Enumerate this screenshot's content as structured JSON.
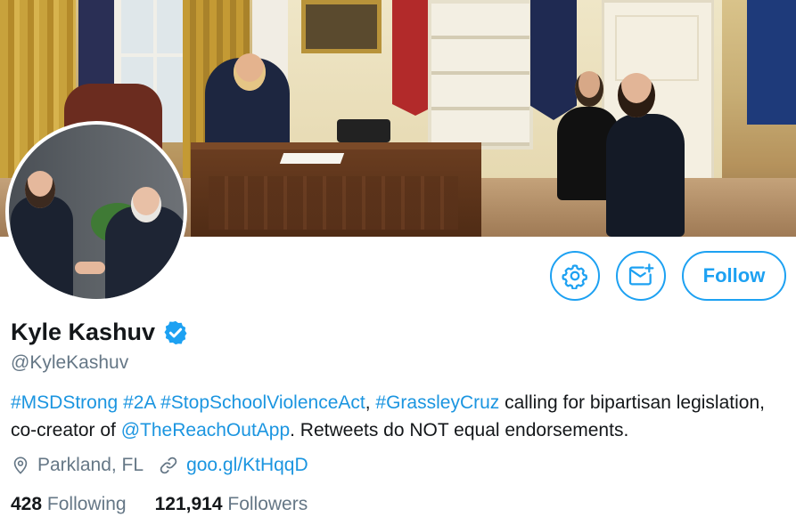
{
  "profile": {
    "name": "Kyle Kashuv",
    "handle": "@KyleKashuv",
    "verified": true,
    "bio": {
      "tag1": "#MSDStrong",
      "tag2": "#2A",
      "tag3": "#StopSchoolViolenceAct",
      "comma": ",",
      "tag4": "#GrassleyCruz",
      "text1": " calling for bipartisan legislation, co-creator of ",
      "mention": "@TheReachOutApp",
      "text2": ". Retweets do NOT equal endorsements."
    },
    "location": "Parkland, FL",
    "website": "goo.gl/KtHqqD"
  },
  "actions": {
    "follow_label": "Follow",
    "settings_icon": "gear-icon",
    "message_icon": "envelope-plus-icon"
  },
  "stats": {
    "following_count": "428",
    "following_label": "Following",
    "followers_count": "121,914",
    "followers_label": "Followers"
  },
  "colors": {
    "accent": "#1da1f2",
    "link": "#1b95e0",
    "muted": "#657786",
    "text": "#14171a"
  }
}
